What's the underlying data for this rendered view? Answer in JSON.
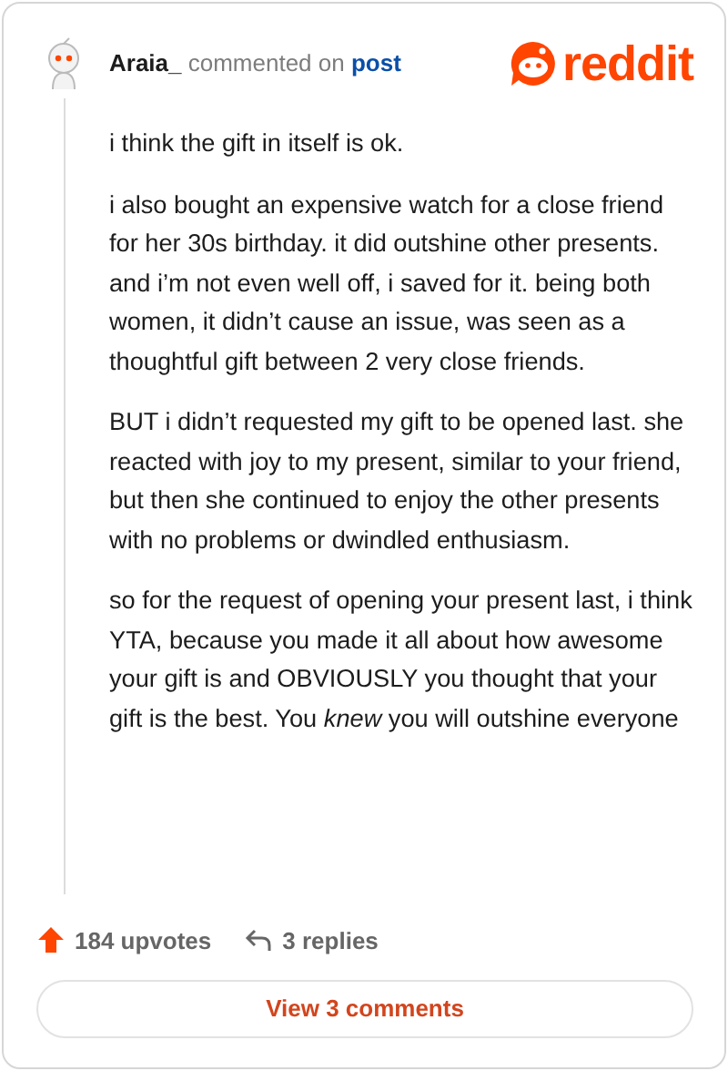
{
  "comment": {
    "author": "Araia_",
    "action": "commented on",
    "target": "post",
    "brand": "reddit",
    "paragraphs": [
      "i think the gift in itself is ok.",
      "i also bought an expensive watch for a close friend for her 30s birthday. it did outshine other presents. and i’m not even well off, i saved for it. being both women, it didn’t cause an issue, was seen as a thoughtful gift between 2 very close friends.",
      "BUT i didn’t requested my gift to be opened last. she reacted with joy to my present, similar to your friend, but then she continued to enjoy the other presents with no problems or dwindled enthusiasm.",
      "so for the request of opening your present last, i think YTA, because you made it all about how awesome your gift is and OBVIOUSLY you thought that your gift is the best. You *knew* you will outshine everyone"
    ]
  },
  "footer": {
    "upvotes": "184 upvotes",
    "replies": "3 replies",
    "button": "View 3 comments"
  }
}
